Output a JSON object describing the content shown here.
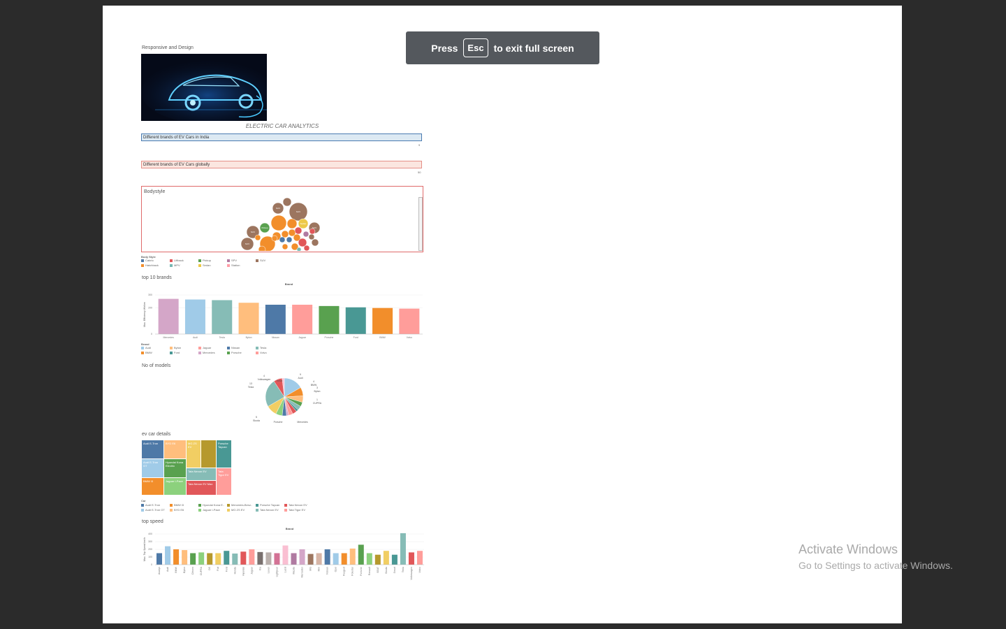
{
  "fullscreen_banner": {
    "press": "Press",
    "key": "Esc",
    "rest": "to exit full screen"
  },
  "dashboard": {
    "header_label": "Responsive and Design",
    "title": "ELECTRIC CAR ANALYTICS",
    "filters": [
      {
        "label": "Different brands of EV Cars in India",
        "count": "9",
        "bg": "#dce9f3",
        "border": "#4a7bb0"
      },
      {
        "label": "Different brands of EV Cars globally",
        "count": "50",
        "bg": "#fbe6e0",
        "border": "#e58f87"
      }
    ]
  },
  "bodystyle": {
    "title": "Bodystyle",
    "legend_title": "Body Style",
    "legend": [
      {
        "name": "Cabrio",
        "color": "#4e79a7"
      },
      {
        "name": "Liftback",
        "color": "#e15759"
      },
      {
        "name": "Pickup",
        "color": "#59a14f"
      },
      {
        "name": "SPV",
        "color": "#b07aa1"
      },
      {
        "name": "SUV",
        "color": "#9c755f"
      },
      {
        "name": "Hatchback",
        "color": "#f28e2b"
      },
      {
        "name": "MPV",
        "color": "#76b7b2"
      },
      {
        "name": "Sedan",
        "color": "#edc948"
      },
      {
        "name": "Station",
        "color": "#ff9da7"
      }
    ],
    "bubble_labels": {
      "suv": "SUV",
      "sedan": "Sedan",
      "pickup": "Pickup"
    }
  },
  "chart_data": [
    {
      "type": "bar",
      "section": "top 10 brands",
      "title": "Brand",
      "ylabel": "Max. Efficiency Wh/km",
      "ylim": [
        0,
        300
      ],
      "yticks": [
        "300",
        "200",
        "0"
      ],
      "categories": [
        "Mercedes",
        "Audi",
        "Tesla",
        "Byton",
        "Nissan",
        "Jaguar",
        "Porsche",
        "Ford",
        "BMW",
        "Volvo"
      ],
      "values": [
        270,
        265,
        260,
        240,
        225,
        225,
        215,
        205,
        200,
        195
      ],
      "colors": [
        "#d4a6c8",
        "#a0cbe8",
        "#86bcb6",
        "#ffbe7d",
        "#4e79a7",
        "#ff9d9a",
        "#59a14f",
        "#499894",
        "#f28e2b",
        "#ff9d9a"
      ],
      "legend_title": "Brand",
      "legend": [
        {
          "name": "Audi",
          "color": "#a0cbe8"
        },
        {
          "name": "Byton",
          "color": "#ffbe7d"
        },
        {
          "name": "Jaguar",
          "color": "#ff9d9a"
        },
        {
          "name": "Nissan",
          "color": "#4e79a7"
        },
        {
          "name": "Tesla",
          "color": "#86bcb6"
        },
        {
          "name": "BMW",
          "color": "#f28e2b"
        },
        {
          "name": "Ford",
          "color": "#499894"
        },
        {
          "name": "Mercedes",
          "color": "#d4a6c8"
        },
        {
          "name": "Porsche",
          "color": "#59a14f"
        },
        {
          "name": "Volvo",
          "color": "#ff9d9a"
        }
      ]
    },
    {
      "type": "pie",
      "section": "No of models",
      "labels": [
        {
          "name": "Audi",
          "value": "9"
        },
        {
          "name": "BMW",
          "value": "4"
        },
        {
          "name": "Byton",
          "value": "3"
        },
        {
          "name": "CUPRA",
          "value": "1"
        },
        {
          "name": "Mercedes",
          "value": ""
        },
        {
          "name": "Porsche",
          "value": ""
        },
        {
          "name": "Skoda",
          "value": "5"
        },
        {
          "name": "Tesla",
          "value": "13"
        },
        {
          "name": "Volkswagen",
          "value": "4"
        },
        {
          "name": "Volvo",
          "value": ""
        }
      ],
      "slices": [
        {
          "value": 9,
          "color": "#a0cbe8"
        },
        {
          "value": 4,
          "color": "#f28e2b"
        },
        {
          "value": 3,
          "color": "#ffbe7d"
        },
        {
          "value": 2,
          "color": "#59a14f"
        },
        {
          "value": 2,
          "color": "#86bcb6"
        },
        {
          "value": 1,
          "color": "#499894"
        },
        {
          "value": 2,
          "color": "#e15759"
        },
        {
          "value": 2,
          "color": "#ff9d9a"
        },
        {
          "value": 1,
          "color": "#d4a6c8"
        },
        {
          "value": 2,
          "color": "#4e79a7"
        },
        {
          "value": 3,
          "color": "#8cd17d"
        },
        {
          "value": 5,
          "color": "#f1ce63"
        },
        {
          "value": 13,
          "color": "#86bcb6"
        },
        {
          "value": 4,
          "color": "#e15759"
        },
        {
          "value": 1,
          "color": "#fabfd2"
        }
      ]
    },
    {
      "type": "heatmap",
      "section": "ev car details",
      "legend_title": "Car",
      "tiles": [
        {
          "label": "Audi E-Tron",
          "color": "#4e79a7"
        },
        {
          "label": "BYD E6",
          "color": "#ffbe7d"
        },
        {
          "label": "MG ZS EV",
          "color": "#f1ce63"
        },
        {
          "label": "",
          "color": "#b6992d"
        },
        {
          "label": "Porsche Taycan",
          "color": "#499894"
        },
        {
          "label": "Audi E-Tron GT",
          "color": "#a0cbe8"
        },
        {
          "label": "Hyundai Kona Electric",
          "color": "#59a14f"
        },
        {
          "label": "Tata Nexon EV",
          "color": "#86bcb6"
        },
        {
          "label": "Tata Tigor EV",
          "color": "#ff9d9a"
        },
        {
          "label": "BMW i3",
          "color": "#f28e2b"
        },
        {
          "label": "Jaguar I-Pace",
          "color": "#8cd17d"
        },
        {
          "label": "Tata Nexon EV Max",
          "color": "#e15759"
        }
      ],
      "legend": [
        {
          "name": "Audi E-Tron",
          "color": "#4e79a7"
        },
        {
          "name": "BMW i3",
          "color": "#f28e2b"
        },
        {
          "name": "Hyundai Kona E..",
          "color": "#59a14f"
        },
        {
          "name": "Mercedes-Benz..",
          "color": "#b6992d"
        },
        {
          "name": "Porsche Taycan",
          "color": "#499894"
        },
        {
          "name": "Tata Nexon EV",
          "color": "#e15759"
        },
        {
          "name": "Audi E-Tron GT",
          "color": "#a0cbe8"
        },
        {
          "name": "BYD E6",
          "color": "#ffbe7d"
        },
        {
          "name": "Jaguar I-Pace",
          "color": "#8cd17d"
        },
        {
          "name": "MG ZS EV",
          "color": "#f1ce63"
        },
        {
          "name": "Tata Nexon EV",
          "color": "#86bcb6"
        },
        {
          "name": "Tata Tigor EV",
          "color": "#ff9d9a"
        }
      ]
    },
    {
      "type": "bar",
      "section": "top speed",
      "title": "Brand",
      "ylabel": "Max. Top Speed km/h",
      "ylim": [
        0,
        400
      ],
      "yticks": [
        "400",
        "300",
        "200",
        "100",
        "0"
      ],
      "categories": [
        "Aiways",
        "Audi",
        "BMW",
        "Byton",
        "Citroen",
        "CUPRA",
        "DS",
        "Fiat",
        "Ford",
        "Honda",
        "Hyundai",
        "Jaguar",
        "Kia",
        "Lexus",
        "Lightyear",
        "Lucid",
        "Mazda",
        "Mercedes",
        "MG",
        "Mini",
        "Nissan",
        "Opel",
        "Peugeot",
        "Polestar",
        "Porsche",
        "Renault",
        "SEAT",
        "Skoda",
        "Smart",
        "Tesla",
        "Volkswagen",
        "Volvo"
      ],
      "values": [
        150,
        240,
        200,
        190,
        150,
        160,
        150,
        150,
        180,
        145,
        170,
        200,
        165,
        160,
        150,
        250,
        150,
        200,
        140,
        150,
        200,
        150,
        150,
        210,
        260,
        150,
        130,
        180,
        130,
        410,
        160,
        180
      ],
      "colors": [
        "#4e79a7",
        "#a0cbe8",
        "#f28e2b",
        "#ffbe7d",
        "#59a14f",
        "#8cd17d",
        "#b6992d",
        "#f1ce63",
        "#499894",
        "#86bcb6",
        "#e15759",
        "#ff9d9a",
        "#79706e",
        "#bab0ac",
        "#d37295",
        "#fabfd2",
        "#b07aa1",
        "#d4a6c8",
        "#9d7660",
        "#d7b5a6",
        "#4e79a7",
        "#a0cbe8",
        "#f28e2b",
        "#ffbe7d",
        "#59a14f",
        "#8cd17d",
        "#b6992d",
        "#f1ce63",
        "#499894",
        "#86bcb6",
        "#e15759",
        "#ff9d9a"
      ]
    }
  ],
  "watermark": {
    "line1": "Activate Windows",
    "line2": "Go to Settings to activate Windows."
  }
}
